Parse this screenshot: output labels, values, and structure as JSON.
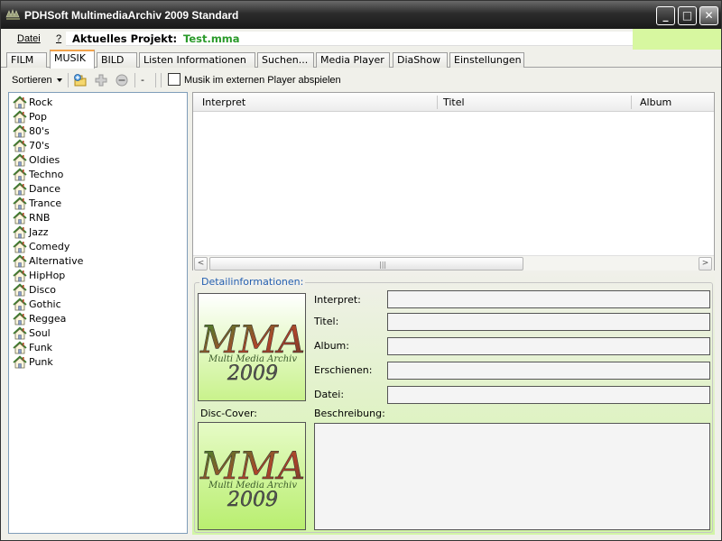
{
  "window": {
    "title": "PDHSoft MultimediaArchiv 2009 Standard",
    "minimize_glyph": "_",
    "maximize_glyph": "□",
    "close_glyph": "✕"
  },
  "menu": {
    "file_label": "Datei",
    "help_label": "?",
    "project_label": "Aktuelles Projekt:",
    "project_value": "Test.mma"
  },
  "tabs": [
    {
      "label": "FILM",
      "active": false
    },
    {
      "label": "MUSIK",
      "active": true
    },
    {
      "label": "BILD",
      "active": false
    },
    {
      "label": "Listen Informationen",
      "active": false
    },
    {
      "label": "Suchen...",
      "active": false
    },
    {
      "label": "Media Player",
      "active": false
    },
    {
      "label": "DiaShow",
      "active": false
    },
    {
      "label": "Einstellungen",
      "active": false
    }
  ],
  "toolbar": {
    "sort_label": "Sortieren",
    "dash": "-",
    "external_player_label": "Musik im externen Player abspielen",
    "external_player_checked": false
  },
  "genres": [
    "Rock",
    "Pop",
    "80's",
    "70's",
    "Oldies",
    "Techno",
    "Dance",
    "Trance",
    "RNB",
    "Jazz",
    "Comedy",
    "Alternative",
    "HipHop",
    "Disco",
    "Gothic",
    "Reggea",
    "Soul",
    "Funk",
    "Punk"
  ],
  "table": {
    "columns": [
      "Interpret",
      "Titel",
      "Album"
    ],
    "rows": [],
    "scroll_left": "<",
    "scroll_right": ">",
    "grip": "|||"
  },
  "detail": {
    "group_title": "Detailinformationen:",
    "fields": [
      {
        "label": "Interpret:",
        "value": ""
      },
      {
        "label": "Titel:",
        "value": ""
      },
      {
        "label": "Album:",
        "value": ""
      },
      {
        "label": "Erschienen:",
        "value": ""
      },
      {
        "label": "Datei:",
        "value": ""
      }
    ],
    "description_label": "Beschreibung:",
    "description_value": "",
    "disc_cover_label": "Disc-Cover:",
    "logo_text": "MMA",
    "logo_subtitle": "Multi Media Archiv",
    "logo_year": "2009"
  },
  "colors": {
    "accent_green": "#2a9a2a",
    "panel_green": "#d2f5a6",
    "tab_highlight": "#f3a24a",
    "group_title_blue": "#2560b0"
  }
}
